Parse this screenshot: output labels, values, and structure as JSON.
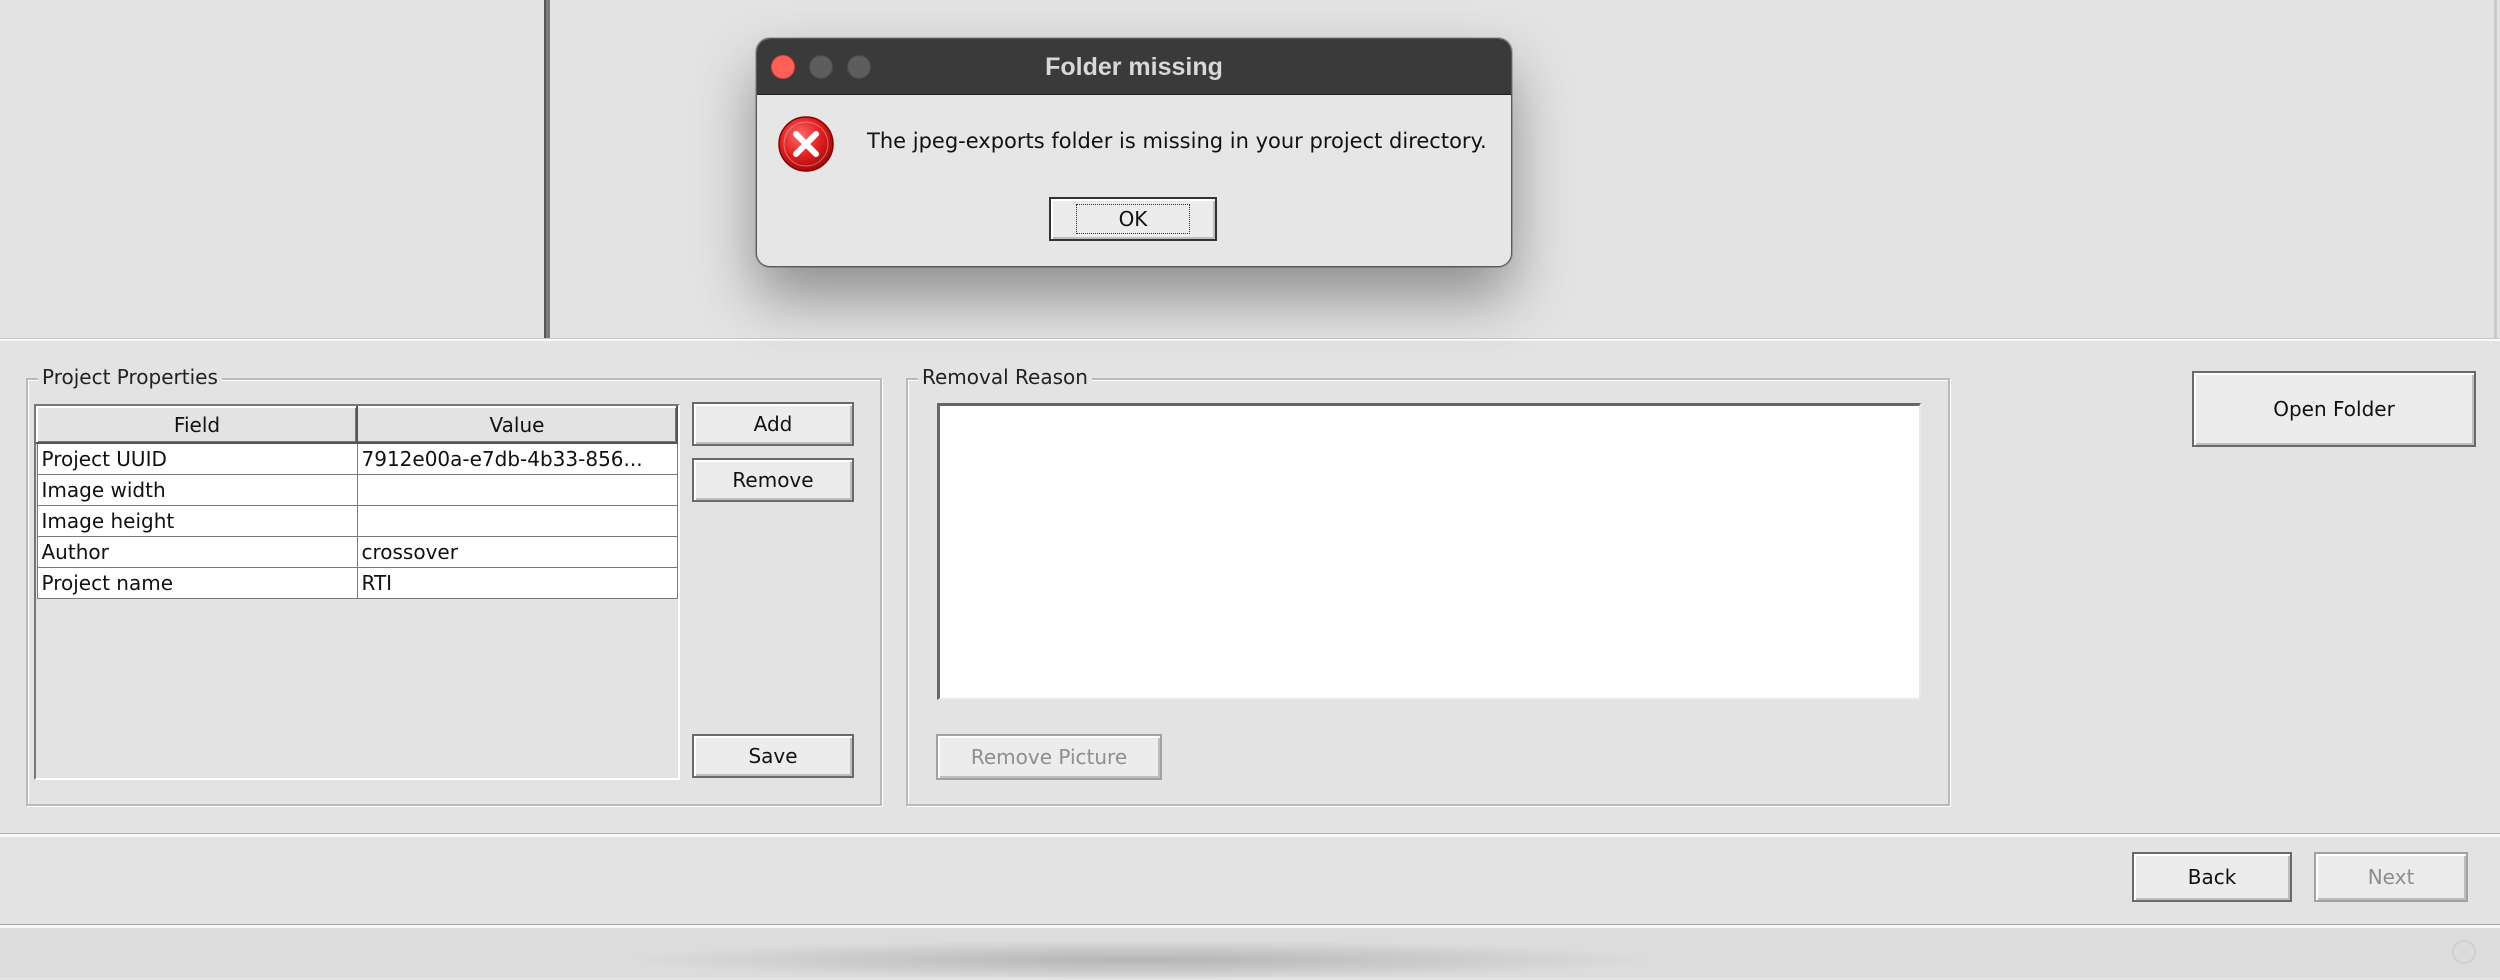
{
  "dialog": {
    "title": "Folder missing",
    "message": "The jpeg-exports folder is missing in your project directory.",
    "ok_label": "OK"
  },
  "project_properties": {
    "title": "Project Properties",
    "columns": [
      "Field",
      "Value"
    ],
    "rows": [
      {
        "field": "Project UUID",
        "value": "7912e00a-e7db-4b33-856..."
      },
      {
        "field": "Image width",
        "value": ""
      },
      {
        "field": "Image height",
        "value": ""
      },
      {
        "field": "Author",
        "value": "crossover"
      },
      {
        "field": "Project name",
        "value": "RTI"
      }
    ],
    "add_label": "Add",
    "remove_label": "Remove",
    "save_label": "Save"
  },
  "removal_reason": {
    "title": "Removal Reason",
    "text": "",
    "remove_picture_label": "Remove Picture"
  },
  "open_folder_label": "Open Folder",
  "nav": {
    "back_label": "Back",
    "next_label": "Next"
  }
}
